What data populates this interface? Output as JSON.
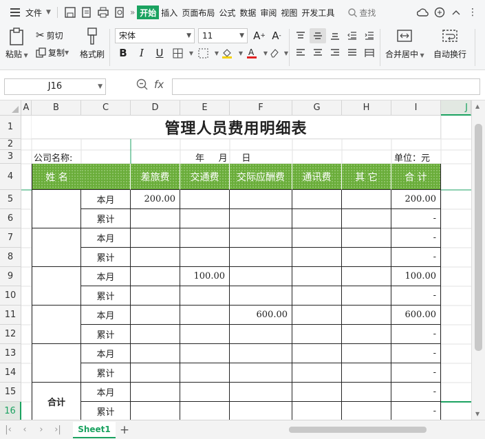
{
  "menubar": {
    "file": "文件",
    "tabs": [
      "开始",
      "插入",
      "页面布局",
      "公式",
      "数据",
      "审阅",
      "视图",
      "开发工具"
    ],
    "search": "查找"
  },
  "ribbon": {
    "paste": "粘贴",
    "cut": "剪切",
    "copy": "复制",
    "format_painter": "格式刷",
    "font_name": "宋体",
    "font_size": "11",
    "merge_center": "合并居中",
    "wrap_text": "自动换行"
  },
  "formula_bar": {
    "name_box": "J16",
    "fx": "fx",
    "value": ""
  },
  "sheet": {
    "columns": [
      "A",
      "B",
      "C",
      "D",
      "E",
      "F",
      "G",
      "H",
      "I",
      "J"
    ],
    "active_column": "J",
    "rows": [
      "1",
      "2",
      "3",
      "4",
      "5",
      "6",
      "7",
      "8",
      "9",
      "10",
      "11",
      "12",
      "13",
      "14",
      "15",
      "16"
    ],
    "active_row": "16",
    "title": "管理人员费用明细表",
    "company_label": "公司名称:",
    "date_label": "年     月     日",
    "unit_label": "单位：元",
    "header": {
      "name": "姓  名",
      "travel": "差旅费",
      "transport": "交通费",
      "entertainment": "交际应酬费",
      "communication": "通讯费",
      "other": "其  它",
      "total": "合  计"
    },
    "period_labels": [
      "本月",
      "累计",
      "本月",
      "累计",
      "本月",
      "累计",
      "本月",
      "累计",
      "本月",
      "累计",
      "本月",
      "累计"
    ],
    "travel_values": [
      "200.00",
      "",
      "",
      "",
      "",
      "",
      "",
      "",
      "",
      "",
      "",
      ""
    ],
    "transport_values": [
      "",
      "",
      "",
      "",
      "100.00",
      "",
      "",
      "",
      "",
      "",
      "",
      ""
    ],
    "entertainment_values": [
      "",
      "",
      "",
      "",
      "",
      "",
      "600.00",
      "",
      "",
      "",
      "",
      ""
    ],
    "total_values": [
      "200.00",
      "-",
      "-",
      "-",
      "100.00",
      "-",
      "600.00",
      "-",
      "-",
      "-",
      "-",
      "-"
    ],
    "grand_total_label": "合计"
  },
  "tabs": {
    "sheet_name": "Sheet1",
    "add": "+"
  },
  "colors": {
    "accent": "#1aa260",
    "header_fill": "#6aad3a"
  }
}
